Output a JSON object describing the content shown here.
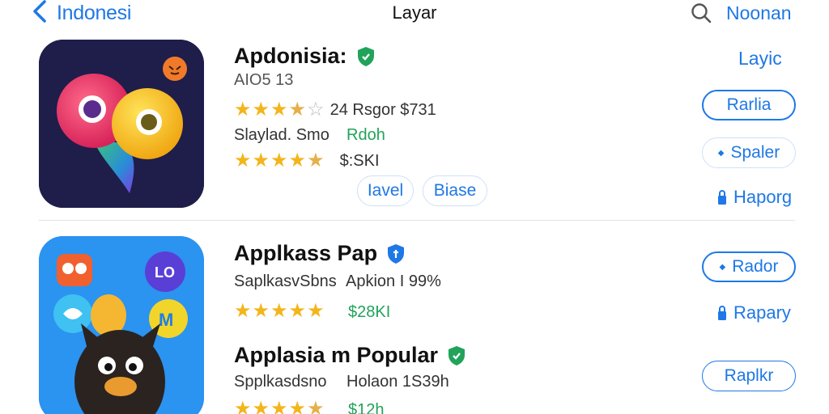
{
  "nav": {
    "back_label": "Indonesi",
    "title": "Layar",
    "right_label": "Noonan"
  },
  "apps": [
    {
      "name": "Apdonisia:",
      "meta1": "AIO5 13",
      "rating_text": "24 Rsgor $731",
      "meta2_a": "Slaylad. Smo",
      "meta2_b": "Rdoh",
      "price": "$:SKI",
      "chip1": "Iavel",
      "chip2": "Biase",
      "side_link": "Layic",
      "button1": "Rarlia",
      "button2": "Spaler",
      "button3": "Haporg",
      "rating1": 3.5,
      "rating2": 4.5
    },
    {
      "name": "Applkass Pap",
      "meta_a": "SaplkasvSbns",
      "meta_b": "Apkion I 99%",
      "price": "$28KI",
      "button1": "Rador",
      "button2": "Rapary",
      "rating": 5
    },
    {
      "name": "Applasia m Popular",
      "meta_a": "Spplkasdsno",
      "meta_b": "Holaon 1S39h",
      "price": "$12h",
      "button1": "Raplkr",
      "rating": 4.5
    }
  ],
  "colors": {
    "accent": "#1e78e6",
    "green": "#21a35a",
    "star": "#f3b51c"
  },
  "icons": {
    "back": "chevron-left-icon",
    "search": "search-icon",
    "verified": "shield-check-icon",
    "lock": "lock-icon"
  }
}
